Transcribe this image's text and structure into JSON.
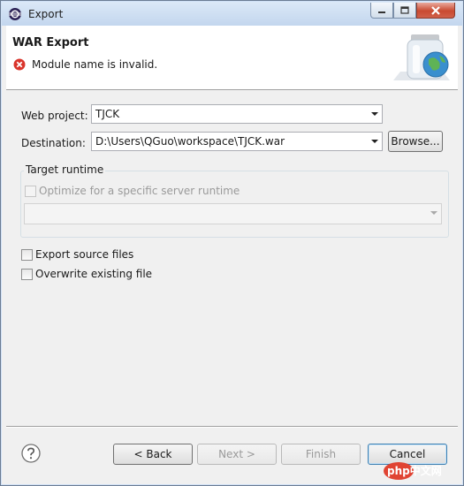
{
  "window": {
    "title": "Export"
  },
  "header": {
    "title": "WAR Export",
    "message": "Module name is invalid."
  },
  "form": {
    "web_project_label": "Web project:",
    "web_project_value": "TJCK",
    "destination_label": "Destination:",
    "destination_value": "D:\\Users\\QGuo\\workspace\\TJCK.war",
    "browse_label": "Browse..."
  },
  "target_runtime": {
    "group_label": "Target runtime",
    "optimize_label": "Optimize for a specific server runtime",
    "runtime_value": ""
  },
  "options": {
    "export_source_label": "Export source files",
    "overwrite_label": "Overwrite existing file"
  },
  "buttons": {
    "back": "< Back",
    "next": "Next >",
    "finish": "Finish",
    "cancel": "Cancel"
  },
  "watermark": {
    "text": "php中文网"
  },
  "colors": {
    "error": "#d9342b",
    "title_bar": "#c3d6ee",
    "dialog_bg": "#f0f0f0",
    "close_button": "#c94a31"
  }
}
